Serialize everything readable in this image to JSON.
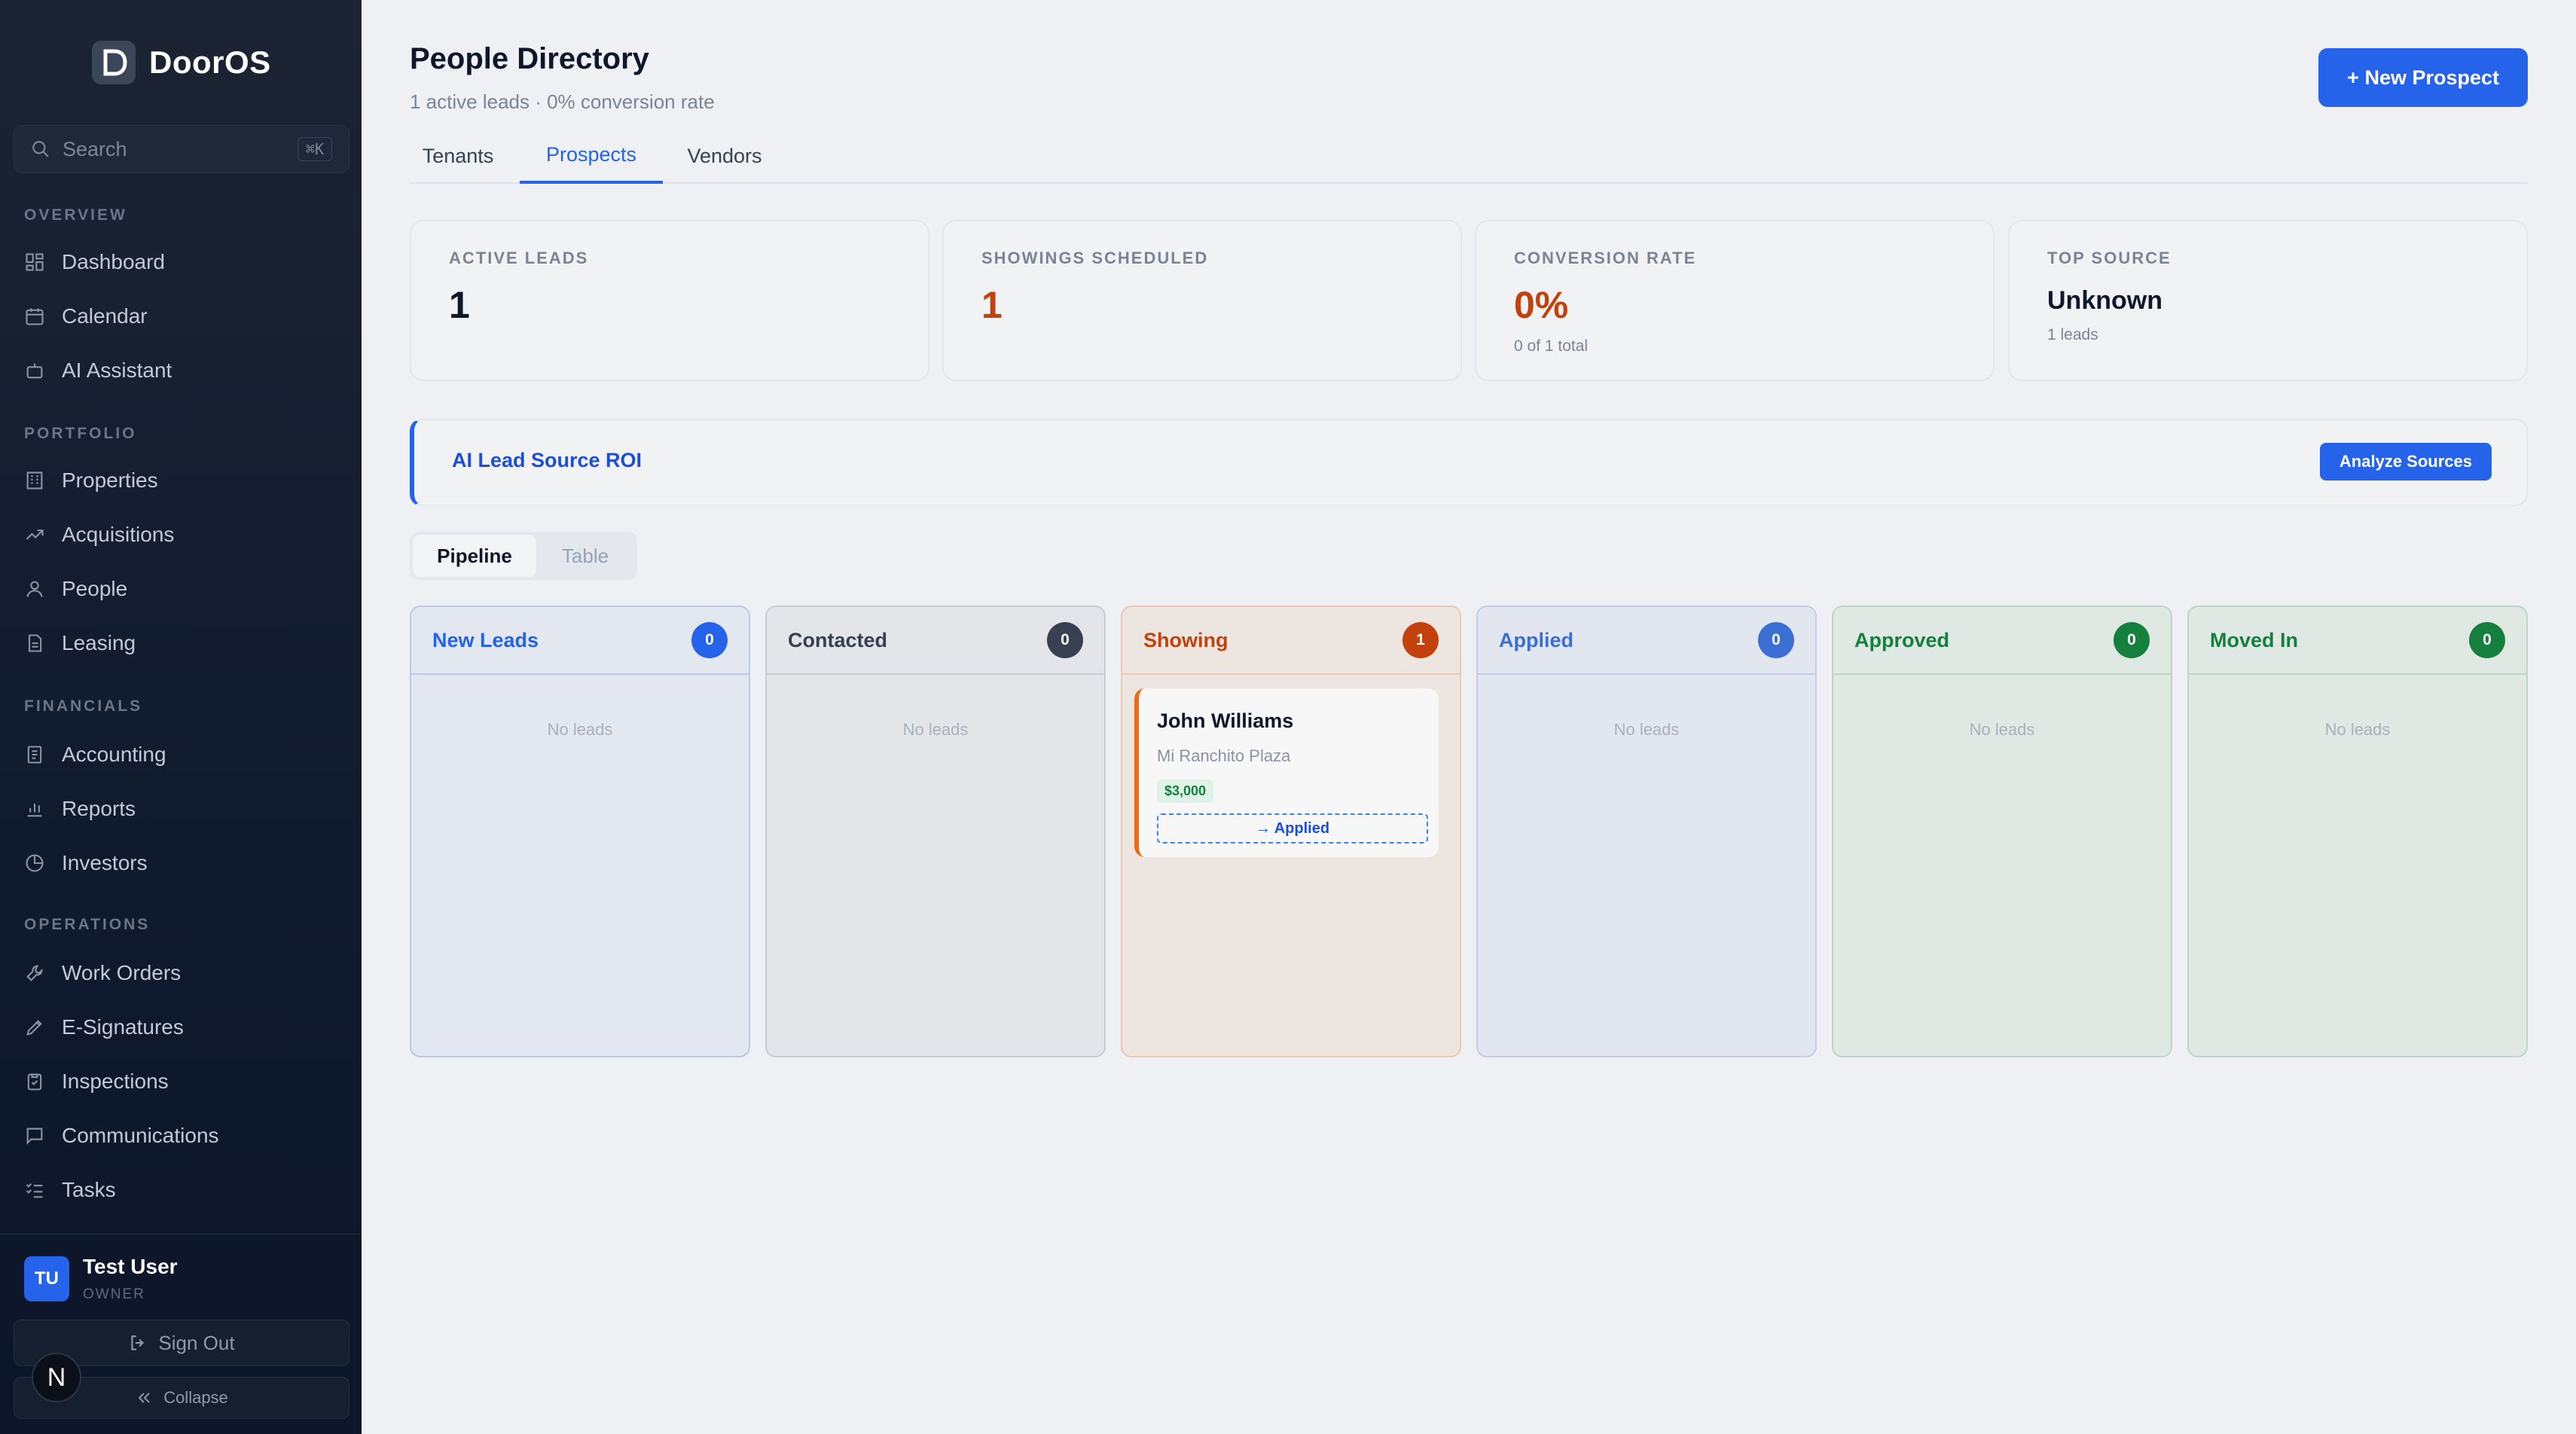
{
  "app": {
    "name": "DoorOS"
  },
  "sidebar": {
    "search": {
      "placeholder": "Search",
      "shortcut": "⌘K"
    },
    "sections": {
      "overview": "OVERVIEW",
      "portfolio": "PORTFOLIO",
      "financials": "FINANCIALS",
      "operations": "OPERATIONS"
    },
    "items": {
      "dashboard": "Dashboard",
      "calendar": "Calendar",
      "ai_assistant": "AI Assistant",
      "properties": "Properties",
      "acquisitions": "Acquisitions",
      "people": "People",
      "leasing": "Leasing",
      "accounting": "Accounting",
      "reports": "Reports",
      "investors": "Investors",
      "work_orders": "Work Orders",
      "e_signatures": "E-Signatures",
      "inspections": "Inspections",
      "communications": "Communications",
      "tasks": "Tasks"
    },
    "user": {
      "initials": "TU",
      "name": "Test User",
      "role": "OWNER"
    },
    "sign_out": "Sign Out",
    "collapse": "Collapse",
    "badge": "N"
  },
  "header": {
    "title": "People Directory",
    "subtitle": "1 active leads · 0% conversion rate",
    "new_button": "+ New Prospect"
  },
  "tabs": [
    "Tenants",
    "Prospects",
    "Vendors"
  ],
  "stats": [
    {
      "label": "ACTIVE LEADS",
      "value": "1",
      "sub": "",
      "color": "#0f172a"
    },
    {
      "label": "SHOWINGS SCHEDULED",
      "value": "1",
      "sub": "",
      "color": "#c2410c"
    },
    {
      "label": "CONVERSION RATE",
      "value": "0%",
      "sub": "0 of 1 total",
      "color": "#c2410c"
    },
    {
      "label": "TOP SOURCE",
      "value": "Unknown",
      "sub": "1 leads",
      "color": "#0f172a"
    }
  ],
  "roi": {
    "title": "AI Lead Source ROI",
    "button": "Analyze Sources"
  },
  "view_toggle": {
    "active": "Pipeline",
    "inactive": "Table"
  },
  "pipeline": [
    {
      "title": "New Leads",
      "count": "0",
      "empty": "No leads",
      "accent": "#2563eb",
      "bg": "#e2e7f0",
      "border": "#bcc9e6"
    },
    {
      "title": "Contacted",
      "count": "0",
      "empty": "No leads",
      "accent": "#374151",
      "bg": "#e3e5e8",
      "border": "#c8ccd3"
    },
    {
      "title": "Showing",
      "count": "1",
      "empty": "",
      "accent": "#c2410c",
      "bg": "#ede5e0",
      "border": "#ecc9b2"
    },
    {
      "title": "Applied",
      "count": "0",
      "empty": "No leads",
      "accent": "#3b6fd4",
      "bg": "#e2e7ef",
      "border": "#c3cee6"
    },
    {
      "title": "Approved",
      "count": "0",
      "empty": "No leads",
      "accent": "#15803d",
      "bg": "#e0e8e3",
      "border": "#bcd6c6"
    },
    {
      "title": "Moved In",
      "count": "0",
      "empty": "No leads",
      "accent": "#15803d",
      "bg": "#e0e8e3",
      "border": "#bcd6c6"
    }
  ],
  "lead": {
    "name": "John Williams",
    "property": "Mi Ranchito Plaza",
    "price": "$3,000",
    "action": "→ Applied"
  }
}
